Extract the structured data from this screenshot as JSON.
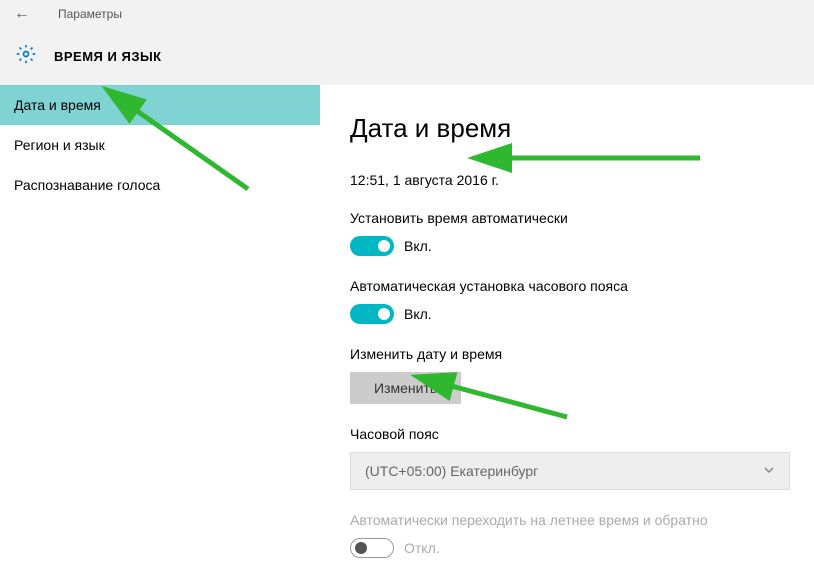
{
  "banner": {
    "title": "Параметры",
    "section": "ВРЕМЯ И ЯЗЫК"
  },
  "sidebar": {
    "items": [
      {
        "label": "Дата и время"
      },
      {
        "label": "Регион и язык"
      },
      {
        "label": "Распознавание голоса"
      }
    ]
  },
  "content": {
    "page_title": "Дата и время",
    "datetime_now": "12:51, 1 августа 2016 г.",
    "auto_time_label": "Установить время автоматически",
    "auto_time_state": "Вкл.",
    "auto_tz_label": "Автоматическая установка часового пояса",
    "auto_tz_state": "Вкл.",
    "change_label": "Изменить дату и время",
    "change_button": "Изменить",
    "tz_label": "Часовой пояс",
    "tz_value": "(UTC+05:00) Екатеринбург",
    "dst_label": "Автоматически переходить на летнее время и обратно",
    "dst_state": "Откл."
  }
}
